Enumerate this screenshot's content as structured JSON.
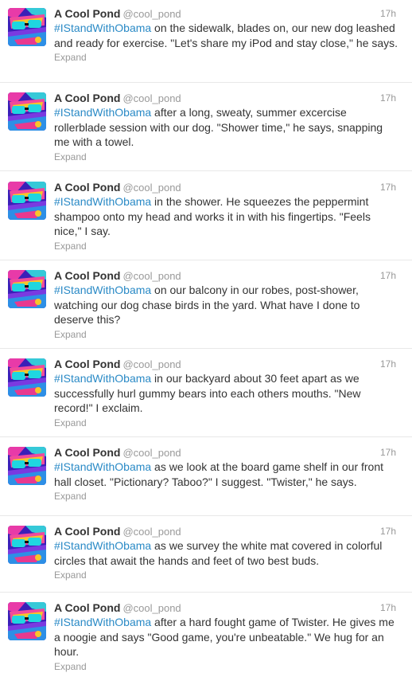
{
  "tweets": [
    {
      "fullname": "A Cool Pond",
      "username": "@cool_pond",
      "time": "17h",
      "hashtag": "#IStandWithObama",
      "text": " on the sidewalk, blades on, our new dog leashed and ready for exercise. \"Let's share my iPod and stay close,\" he says.",
      "expand": "Expand"
    },
    {
      "fullname": "A Cool Pond",
      "username": "@cool_pond",
      "time": "17h",
      "hashtag": "#IStandWithObama",
      "text": " after a long, sweaty, summer excercise rollerblade session with our dog. \"Shower time,\" he says, snapping me with a towel.",
      "expand": "Expand"
    },
    {
      "fullname": "A Cool Pond",
      "username": "@cool_pond",
      "time": "17h",
      "hashtag": "#IStandWithObama",
      "text": " in the shower. He squeezes the peppermint shampoo onto my head and works it in with his fingertips. \"Feels nice,\" I say.",
      "expand": "Expand"
    },
    {
      "fullname": "A Cool Pond",
      "username": "@cool_pond",
      "time": "17h",
      "hashtag": "#IStandWithObama",
      "text": " on our balcony in our robes, post-shower, watching our dog chase birds in the yard. What have I done to deserve this?",
      "expand": "Expand"
    },
    {
      "fullname": "A Cool Pond",
      "username": "@cool_pond",
      "time": "17h",
      "hashtag": "#IStandWithObama",
      "text": " in our backyard about 30 feet apart as we successfully hurl gummy bears into each others mouths. \"New record!\" I exclaim.",
      "expand": "Expand"
    },
    {
      "fullname": "A Cool Pond",
      "username": "@cool_pond",
      "time": "17h",
      "hashtag": "#IStandWithObama",
      "text": " as we look at the board game shelf in our front hall closet. \"Pictionary? Taboo?\" I suggest. \"Twister,\" he says.",
      "expand": "Expand"
    },
    {
      "fullname": "A Cool Pond",
      "username": "@cool_pond",
      "time": "17h",
      "hashtag": "#IStandWithObama",
      "text": " as we survey the white mat covered in colorful circles that await the hands and feet of two best buds.",
      "expand": "Expand"
    },
    {
      "fullname": "A Cool Pond",
      "username": "@cool_pond",
      "time": "17h",
      "hashtag": "#IStandWithObama",
      "text": " after a hard fought game of Twister. He gives me a noogie and says \"Good game, you're unbeatable.\" We hug for an hour.",
      "expand": "Expand"
    }
  ],
  "colors": {
    "hashtag": "#2a8ac6",
    "meta": "#999999",
    "text": "#333333",
    "divider": "#e8e8e8"
  },
  "avatar_icon": "pond-avatar-icon"
}
